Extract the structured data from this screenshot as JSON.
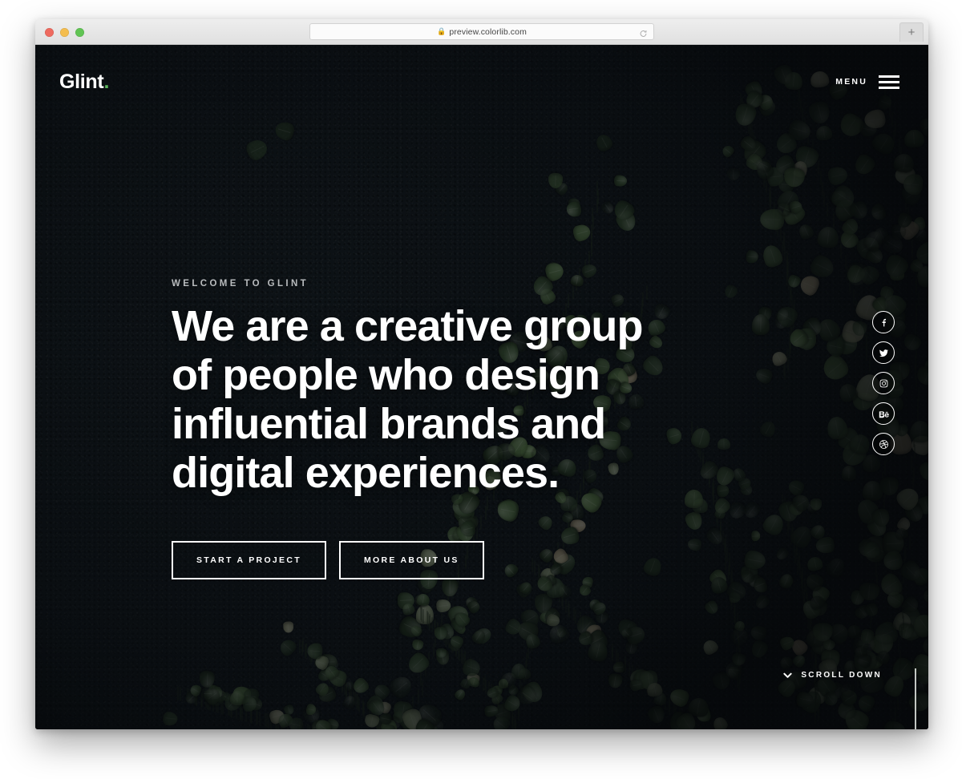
{
  "browser": {
    "url": "preview.colorlib.com",
    "lock_icon": "lock-icon",
    "reload_icon": "reload-icon",
    "newtab_label": "+",
    "traffic_lights": [
      "close-red",
      "minimize-yellow",
      "maximize-green"
    ]
  },
  "site": {
    "logo_text": "Glint",
    "logo_accent": ".",
    "accent_color": "#5cb85c",
    "background_color": "#0d1216",
    "text_color": "#ffffff"
  },
  "header": {
    "menu_label": "MENU",
    "menu_icon": "hamburger-icon"
  },
  "hero": {
    "eyebrow": "WELCOME TO GLINT",
    "headline_lines": [
      "We are a creative group",
      "of people who design",
      "influential brands and",
      "digital experiences."
    ],
    "buttons": [
      {
        "label": "START A PROJECT",
        "name": "start-a-project-button"
      },
      {
        "label": "MORE ABOUT US",
        "name": "more-about-us-button"
      }
    ]
  },
  "social": [
    {
      "name": "facebook",
      "icon": "facebook-icon"
    },
    {
      "name": "twitter",
      "icon": "twitter-icon"
    },
    {
      "name": "instagram",
      "icon": "instagram-icon"
    },
    {
      "name": "behance",
      "icon": "behance-icon"
    },
    {
      "name": "dribbble",
      "icon": "dribbble-icon"
    }
  ],
  "scroll": {
    "label": "SCROLL DOWN",
    "icon": "chevron-down-icon"
  }
}
